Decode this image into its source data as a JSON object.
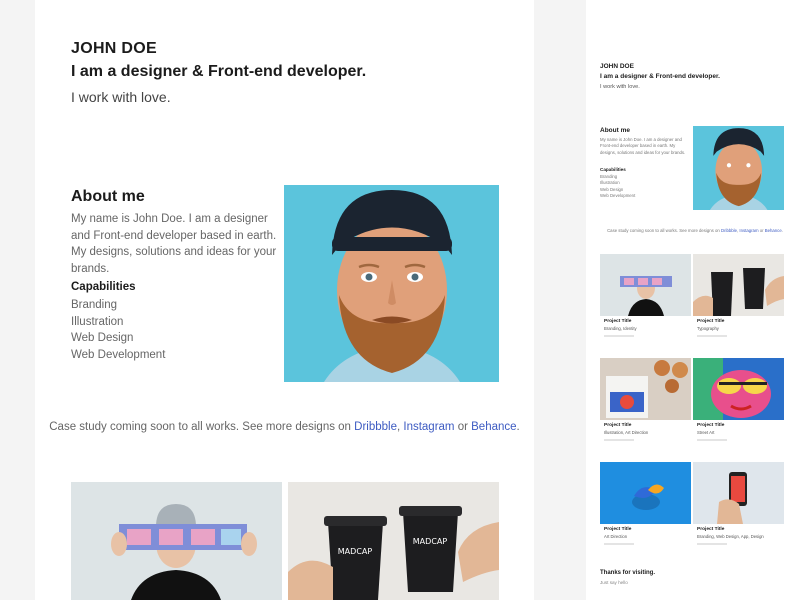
{
  "header": {
    "name": "JOHN DOE",
    "tagline": "I am a designer & Front-end developer.",
    "subline": "I work with love."
  },
  "about": {
    "title": "About me",
    "text": "My name is John Doe. I am a designer and Front-end developer based in earth. My designs, solutions and ideas for your brands.",
    "capabilities_title": "Capabilities",
    "capabilities": [
      "Branding",
      "Illustration",
      "Web Design",
      "Web Development"
    ]
  },
  "case_study": {
    "prefix": "Case study coming soon to all works. See more designs on ",
    "link1": "Dribbble",
    "sep1": ", ",
    "link2": "Instagram",
    "sep2": " or ",
    "link3": "Behance",
    "suffix": "."
  },
  "projects": [
    {
      "title": "Project Title",
      "category": "Branding, Identity"
    },
    {
      "title": "Project Title",
      "category": "Typography"
    },
    {
      "title": "Project Title",
      "category": "Illustration, Art Direction"
    },
    {
      "title": "Project Title",
      "category": "Street Art"
    },
    {
      "title": "Project Title",
      "category": "Art Direction"
    },
    {
      "title": "Project Title",
      "category": "Branding, Web Design, App, Design"
    }
  ],
  "footer": {
    "thanks": "Thanks for visiting.",
    "hello": "Just say hello"
  },
  "colors": {
    "link": "#3d5bc2",
    "portrait_bg": "#5bc4dc",
    "background": "#f4f4f4"
  },
  "icons": [
    "portrait-photo",
    "poster-photo",
    "coffee-cups-photo",
    "magazine-photo",
    "street-art-photo",
    "lemon-photo",
    "phone-photo"
  ]
}
